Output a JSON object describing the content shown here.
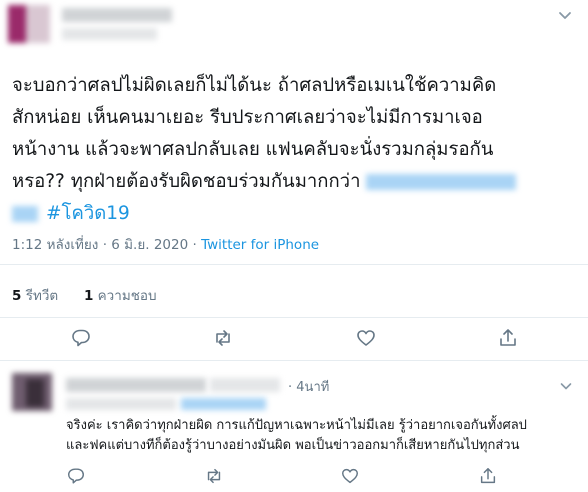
{
  "tweet": {
    "text_lines": [
      "จะบอกว่าศลปไม่ผิดเลยก็ไม่ได้นะ ถ้าศลปหรือเมเนใช้ความคิด",
      "สักหน่อย เห็นคนมาเยอะ รีบประกาศเลยว่าจะไม่มีการมาเจอ",
      "หน้างาน แล้วจะพาศลปกลับเลย แฟนคลับจะนั่งรวมกลุ่มรอกัน",
      "หรอ?? ทุกฝ่ายต้องรับผิดชอบร่วมกันมากกว่า"
    ],
    "hashtag": "#โควิด19",
    "time": "1:12 หลังเที่ยง",
    "date": "6 มิ.ย. 2020",
    "separator": "·",
    "source": "Twitter for iPhone",
    "retweet_count": "5",
    "retweet_label": "รีทวีต",
    "like_count": "1",
    "like_label": "ความชอบ"
  },
  "reply": {
    "time": "4นาที",
    "dot": "·",
    "text_lines": [
      "จริงค่ะ เราคิดว่าทุกฝ่ายผิด การแก้ปัญหาเฉพาะหน้าไม่มีเลย รู้ว่าอยากเจอกันทั้งศลป",
      "และฟคแต่บางทีก็ต้องรู้ว่าบางอย่างมันผิด พอเป็นข่าวออกมาก็เสียหายกันไปทุกส่วน"
    ]
  },
  "icons": {
    "chevron": "chevron-down-icon",
    "reply": "reply-icon",
    "retweet": "retweet-icon",
    "like": "heart-icon",
    "share": "share-icon"
  },
  "colors": {
    "accent": "#1b95e0",
    "muted": "#657786",
    "text": "#14171a",
    "divider": "#e6ecf0"
  }
}
